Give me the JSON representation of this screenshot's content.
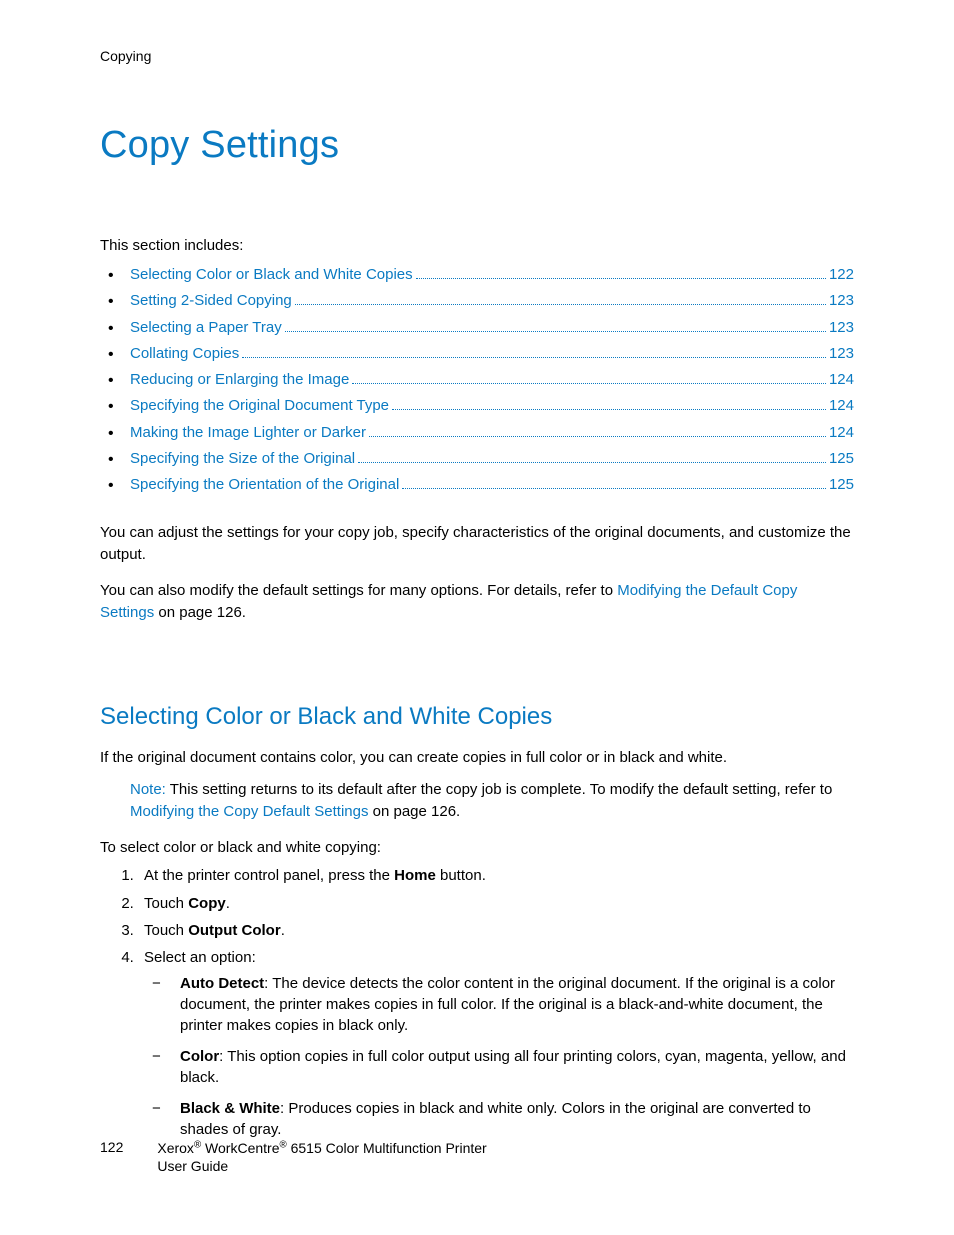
{
  "header": {
    "section": "Copying"
  },
  "title": "Copy Settings",
  "section_includes_label": "This section includes:",
  "toc": [
    {
      "label": "Selecting Color or Black and White Copies",
      "page": "122"
    },
    {
      "label": "Setting 2-Sided Copying",
      "page": "123"
    },
    {
      "label": "Selecting a Paper Tray",
      "page": "123"
    },
    {
      "label": "Collating Copies",
      "page": "123"
    },
    {
      "label": "Reducing or Enlarging the Image",
      "page": "124"
    },
    {
      "label": "Specifying the Original Document Type",
      "page": "124"
    },
    {
      "label": "Making the Image Lighter or Darker",
      "page": "124"
    },
    {
      "label": "Specifying the Size of the Original",
      "page": "125"
    },
    {
      "label": "Specifying the Orientation of the Original",
      "page": "125"
    }
  ],
  "intro_para_1": "You can adjust the settings for your copy job, specify characteristics of the original documents, and customize the output.",
  "intro_para_2_pre": "You can also modify the default settings for many options. For details, refer to ",
  "intro_para_2_link": "Modifying the Default Copy Settings",
  "intro_para_2_post": " on page 126.",
  "subheading": "Selecting Color or Black and White Copies",
  "sub_intro": "If the original document contains color, you can create copies in full color or in black and white.",
  "note": {
    "label": "Note:",
    "text_pre": " This setting returns to its default after the copy job is complete. To modify the default setting, refer to ",
    "link": "Modifying the Copy Default Settings",
    "text_post": " on page 126."
  },
  "steps_intro": "To select color or black and white copying:",
  "steps": {
    "s1_pre": "At the printer control panel, press the ",
    "s1_bold": "Home",
    "s1_post": " button.",
    "s2_pre": "Touch ",
    "s2_bold": "Copy",
    "s2_post": ".",
    "s3_pre": "Touch ",
    "s3_bold": "Output Color",
    "s3_post": ".",
    "s4": "Select an option:"
  },
  "options": {
    "o1_bold": "Auto Detect",
    "o1_rest": ": The device detects the color content in the original document. If the original is a color document, the printer makes copies in full color. If the original is a black-and-white document, the printer makes copies in black only.",
    "o2_bold": "Color",
    "o2_rest": ": This option copies in full color output using all four printing colors, cyan, magenta, yellow, and black.",
    "o3_bold": "Black & White",
    "o3_rest": ": Produces copies in black and white only. Colors in the original are converted to shades of gray."
  },
  "footer": {
    "page_number": "122",
    "line1_pre": "Xerox",
    "line1_mid": " WorkCentre",
    "line1_post": " 6515 Color Multifunction Printer",
    "line2": "User Guide"
  }
}
